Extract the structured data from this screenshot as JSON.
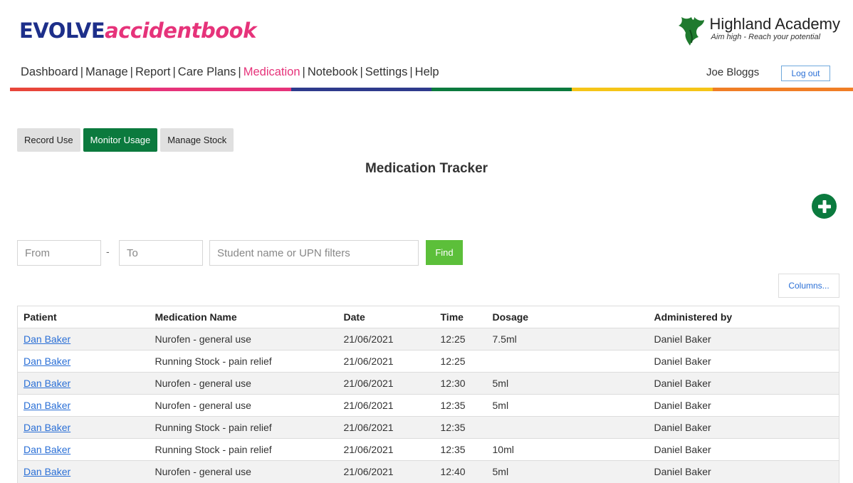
{
  "brand": {
    "part1": "EVOLVE",
    "part2": "accidentbook"
  },
  "school": {
    "name": "Highland Academy",
    "motto": "Aim high - Reach your potential"
  },
  "nav": {
    "items": [
      {
        "label": "Dashboard",
        "active": false
      },
      {
        "label": "Manage",
        "active": false
      },
      {
        "label": "Report",
        "active": false
      },
      {
        "label": "Care Plans",
        "active": false
      },
      {
        "label": "Medication",
        "active": true
      },
      {
        "label": "Notebook",
        "active": false
      },
      {
        "label": "Settings",
        "active": false
      },
      {
        "label": "Help",
        "active": false
      }
    ],
    "separator": "|"
  },
  "user": {
    "name": "Joe Bloggs",
    "logout_label": "Log out"
  },
  "rainbow_colors": [
    "#e8463a",
    "#e6337a",
    "#2e3a8c",
    "#0b7a3e",
    "#f5c518",
    "#f07e26"
  ],
  "tabs": [
    {
      "label": "Record Use",
      "active": false
    },
    {
      "label": "Monitor Usage",
      "active": true
    },
    {
      "label": "Manage Stock",
      "active": false
    }
  ],
  "page_title": "Medication Tracker",
  "filters": {
    "from_placeholder": "From",
    "dash": "-",
    "to_placeholder": "To",
    "search_placeholder": "Student name or UPN filters",
    "find_label": "Find"
  },
  "columns_label": "Columns...",
  "table": {
    "headers": [
      "Patient",
      "Medication Name",
      "Date",
      "Time",
      "Dosage",
      "Administered by"
    ],
    "rows": [
      [
        "Dan Baker",
        "Nurofen - general use",
        "21/06/2021",
        "12:25",
        "7.5ml",
        "Daniel Baker"
      ],
      [
        "Dan Baker",
        "Running Stock - pain relief",
        "21/06/2021",
        "12:25",
        "",
        "Daniel Baker"
      ],
      [
        "Dan Baker",
        "Nurofen - general use",
        "21/06/2021",
        "12:30",
        "5ml",
        "Daniel Baker"
      ],
      [
        "Dan Baker",
        "Nurofen - general use",
        "21/06/2021",
        "12:35",
        "5ml",
        "Daniel Baker"
      ],
      [
        "Dan Baker",
        "Running Stock - pain relief",
        "21/06/2021",
        "12:35",
        "",
        "Daniel Baker"
      ],
      [
        "Dan Baker",
        "Running Stock - pain relief",
        "21/06/2021",
        "12:35",
        "10ml",
        "Daniel Baker"
      ],
      [
        "Dan Baker",
        "Nurofen - general use",
        "21/06/2021",
        "12:40",
        "5ml",
        "Daniel Baker"
      ]
    ]
  },
  "colors": {
    "accent_green": "#0b7a3e",
    "find_green": "#5cbf3a",
    "brand_blue": "#1d2f8a",
    "brand_pink": "#e6337a",
    "link_blue": "#2a6fd6"
  }
}
